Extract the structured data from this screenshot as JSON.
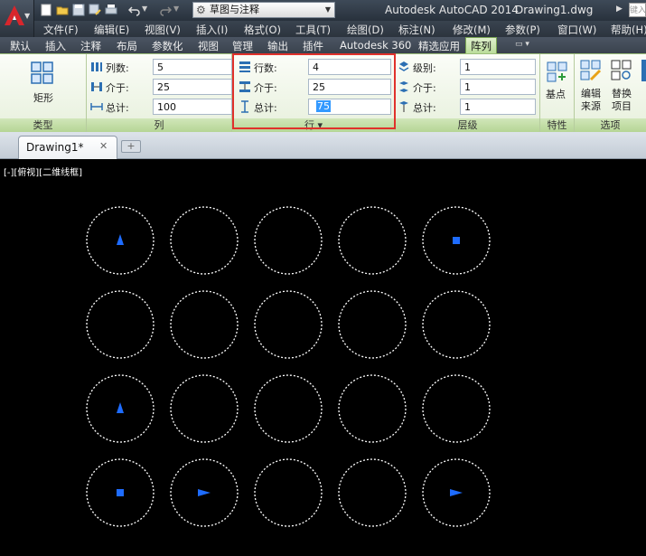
{
  "titlebar": {
    "workspace": "草图与注释",
    "app_title": "Autodesk AutoCAD 2014",
    "file_title": "Drawing1.dwg",
    "search_placeholder": "键入"
  },
  "menu": [
    "文件(F)",
    "编辑(E)",
    "视图(V)",
    "插入(I)",
    "格式(O)",
    "工具(T)",
    "绘图(D)",
    "标注(N)",
    "修改(M)",
    "参数(P)",
    "窗口(W)",
    "帮助(H)"
  ],
  "ribbon_tabs": [
    "默认",
    "插入",
    "注释",
    "布局",
    "参数化",
    "视图",
    "管理",
    "输出",
    "插件",
    "Autodesk 360",
    "精选应用",
    "阵列"
  ],
  "ribbon": {
    "type_panel": {
      "button": "矩形",
      "label": "类型"
    },
    "columns_panel": {
      "label": "列",
      "count_label": "列数:",
      "count": "5",
      "between_label": "介于:",
      "between": "25",
      "total_label": "总计:",
      "total": "100"
    },
    "rows_panel": {
      "label": "行 ▾",
      "count_label": "行数:",
      "count": "4",
      "between_label": "介于:",
      "between": "25",
      "total_label": "总计:",
      "total": "75"
    },
    "levels_panel": {
      "label": "层级",
      "count_label": "级别:",
      "count": "1",
      "between_label": "介于:",
      "between": "1",
      "total_label": "总计:",
      "total": "1"
    },
    "props_panel": {
      "button": "基点",
      "label": "特性"
    },
    "options_panel": {
      "edit_source": [
        "编辑",
        "来源"
      ],
      "replace_item": [
        "替换",
        "项目"
      ],
      "label": "选项"
    }
  },
  "file_tabs": {
    "active": "Drawing1*"
  },
  "viewport": {
    "label": "[-][俯视][二维线框]"
  },
  "drawing": {
    "rows": 4,
    "columns": 5,
    "circle_color": "#ffffff",
    "marker_color": "#1e6cff",
    "markers": [
      {
        "row": 0,
        "col": 0,
        "shape": "triangle-up"
      },
      {
        "row": 0,
        "col": 4,
        "shape": "square"
      },
      {
        "row": 2,
        "col": 0,
        "shape": "triangle-up"
      },
      {
        "row": 3,
        "col": 0,
        "shape": "square"
      },
      {
        "row": 3,
        "col": 1,
        "shape": "triangle-right"
      },
      {
        "row": 3,
        "col": 4,
        "shape": "triangle-right"
      }
    ]
  },
  "colors": {
    "ribbon_active": "#b9dc98",
    "highlight": "#e0312b",
    "canvas": "#000000"
  }
}
